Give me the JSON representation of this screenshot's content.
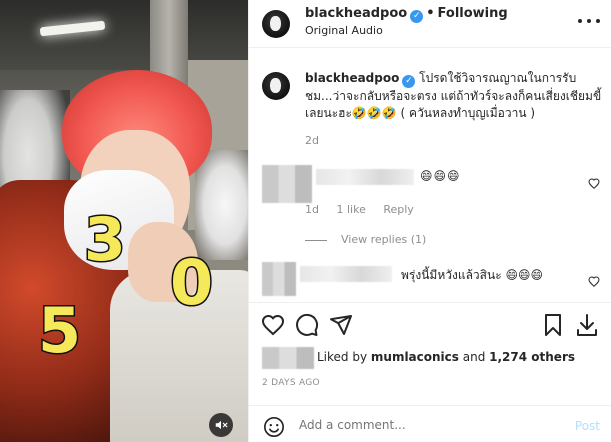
{
  "media": {
    "overlay_digits": [
      "3",
      "0",
      "5"
    ],
    "mute_icon": "speaker-muted-icon"
  },
  "header": {
    "username": "blackheadpoo",
    "separator": "•",
    "follow_status": "Following",
    "subtitle": "Original Audio",
    "more_icon": "more-horizontal-icon"
  },
  "caption": {
    "username": "blackheadpoo",
    "text": " โปรดใช้วิจารณญาณในการรับชม...ว่าจะกลับหรือจะตรง แต่ถ้าทัวร์จะลงก็คนเสี่ยงเชียมขี้เลยนะฮะ🤣🤣🤣 ( ควันหลงทำบุญเมื่อวาน )",
    "time": "2d"
  },
  "comments": [
    {
      "text": "😄😄😄",
      "time": "1d",
      "likes": "1 like",
      "reply": "Reply"
    },
    {
      "text": "พรุ่งนี้มีหวังแล้วสินะ 😄😄😄"
    }
  ],
  "view_replies": "View replies (1)",
  "likes": {
    "prefix": "Liked by ",
    "user": "mumlaconics",
    "middle": " and ",
    "others": "1,274 others"
  },
  "posted_ago": "2 DAYS AGO",
  "add_comment": {
    "placeholder": "Add a comment...",
    "post_label": "Post"
  },
  "colors": {
    "verified": "#3897f0",
    "post_disabled": "#b2dffc",
    "meta_gray": "#8e8e8e"
  }
}
